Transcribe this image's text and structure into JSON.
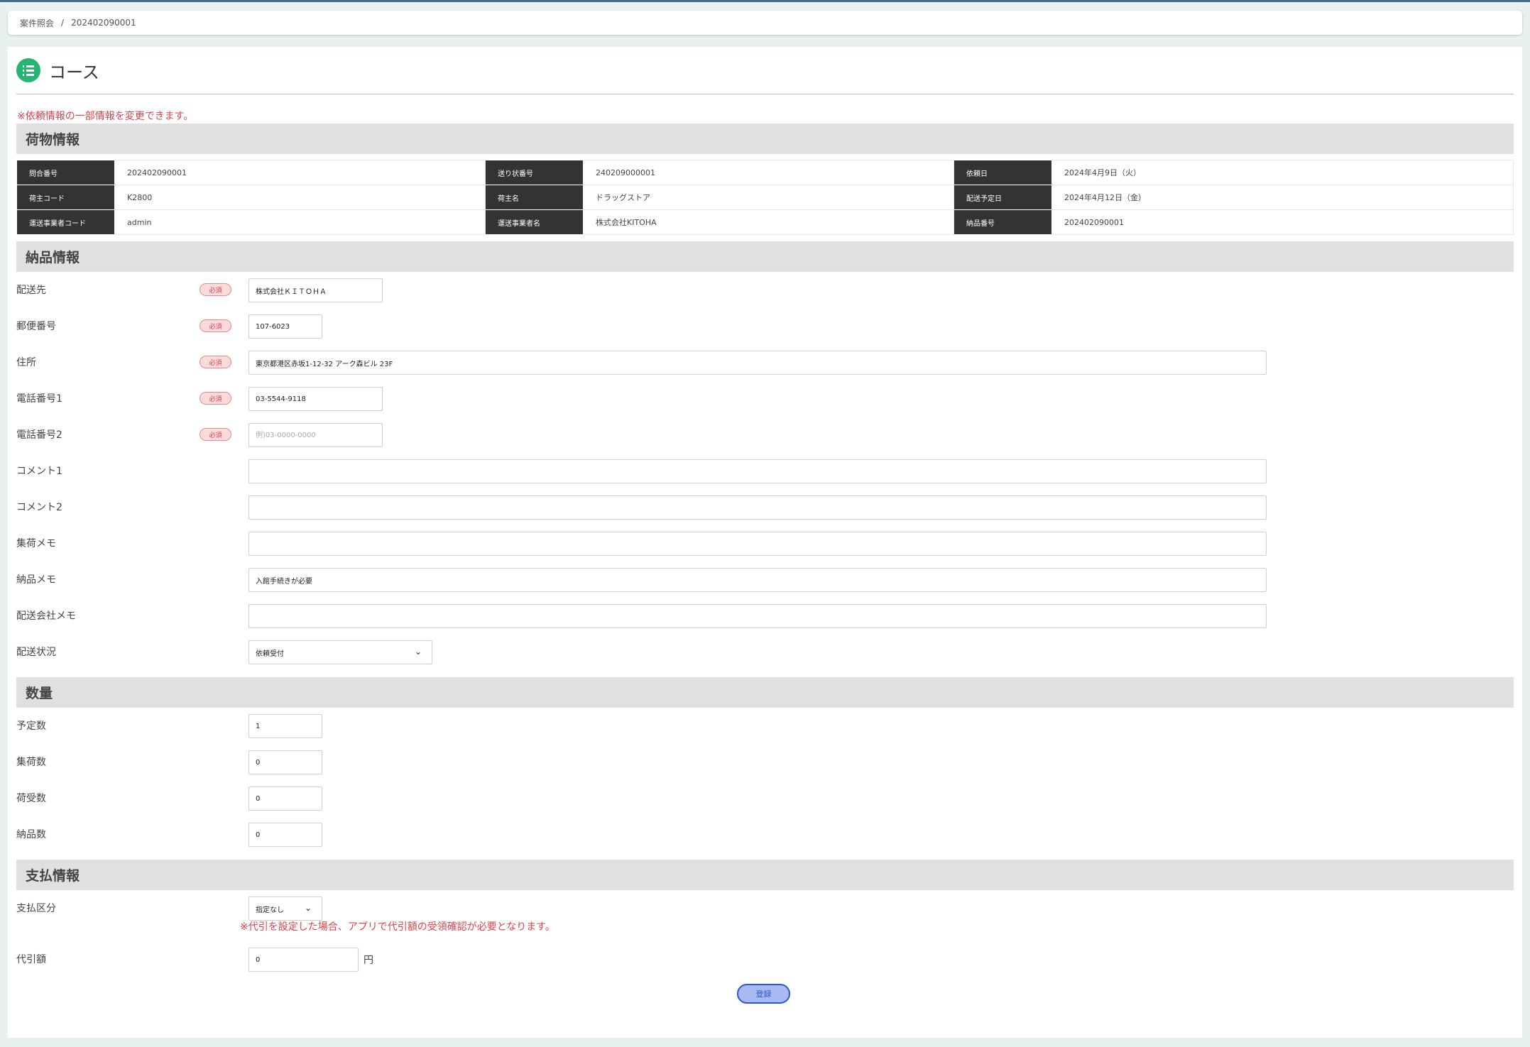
{
  "breadcrumb": {
    "parent": "案件照会",
    "separator": "/",
    "current": "202402090001"
  },
  "page": {
    "title": "コース",
    "notice": "※依頼情報の一部情報を変更できます。"
  },
  "sections": {
    "cargo": "荷物情報",
    "delivery": "納品情報",
    "quantity": "数量",
    "payment": "支払情報"
  },
  "cargo_info": [
    [
      {
        "label": "問合番号",
        "value": "202402090001"
      },
      {
        "label": "送り状番号",
        "value": "240209000001"
      },
      {
        "label": "依頼日",
        "value": "2024年4月9日（火）"
      }
    ],
    [
      {
        "label": "荷主コード",
        "value": "K2800"
      },
      {
        "label": "荷主名",
        "value": "ドラッグストア"
      },
      {
        "label": "配送予定日",
        "value": "2024年4月12日（金）"
      }
    ],
    [
      {
        "label": "運送事業者コード",
        "value": "admin"
      },
      {
        "label": "運送事業者名",
        "value": "株式会社KITOHA"
      },
      {
        "label": "納品番号",
        "value": "202402090001"
      }
    ]
  ],
  "required_badge": "必須",
  "delivery": {
    "destination": {
      "label": "配送先",
      "value": "株式会社ＫＩＴＯＨＡ"
    },
    "postal": {
      "label": "郵便番号",
      "value": "107-6023"
    },
    "address": {
      "label": "住所",
      "value": "東京都港区赤坂1-12-32 アーク森ビル 23F"
    },
    "phone1": {
      "label": "電話番号1",
      "value": "03-5544-9118"
    },
    "phone2": {
      "label": "電話番号2",
      "value": "",
      "placeholder": "例)03-0000-0000"
    },
    "comment1": {
      "label": "コメント1",
      "value": ""
    },
    "comment2": {
      "label": "コメント2",
      "value": ""
    },
    "pickup_memo": {
      "label": "集荷メモ",
      "value": ""
    },
    "delivery_memo": {
      "label": "納品メモ",
      "value": "入館手続きが必要"
    },
    "company_memo": {
      "label": "配送会社メモ",
      "value": ""
    },
    "status": {
      "label": "配送状況",
      "value": "依頼受付"
    }
  },
  "quantity": {
    "planned": {
      "label": "予定数",
      "value": "1"
    },
    "collected": {
      "label": "集荷数",
      "value": "0"
    },
    "received": {
      "label": "荷受数",
      "value": "0"
    },
    "delivered": {
      "label": "納品数",
      "value": "0"
    }
  },
  "payment": {
    "category": {
      "label": "支払区分",
      "value": "指定なし"
    },
    "note": "※代引を設定した場合、アプリで代引額の受領確認が必要となります。",
    "cod": {
      "label": "代引額",
      "value": "0",
      "unit": "円"
    }
  },
  "submit_label": "登録",
  "colors": {
    "accent_green": "#28b573",
    "alert_red": "#d9434b",
    "button_blue": "#2f56c9"
  }
}
